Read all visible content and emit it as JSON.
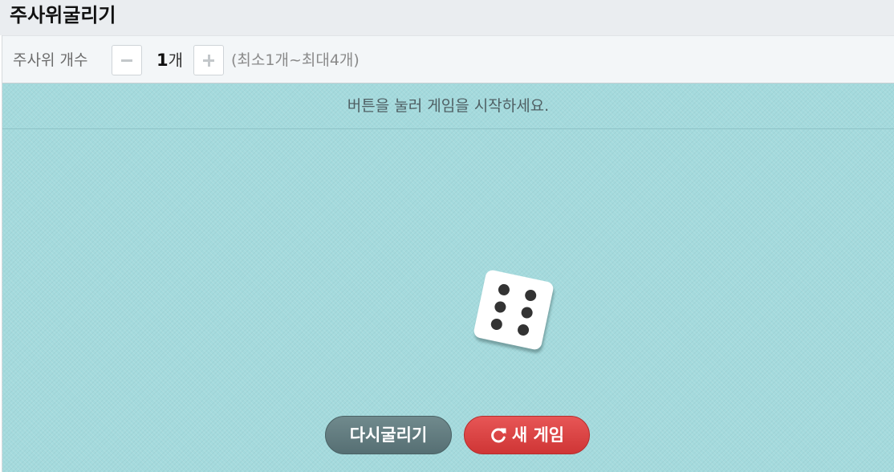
{
  "header": {
    "title": "주사위굴리기"
  },
  "controls": {
    "label": "주사위 개수",
    "count_value": "1",
    "count_unit": "개",
    "range_hint": "(최소1개~최대4개)",
    "minus_icon": "minus-icon",
    "plus_icon": "plus-icon"
  },
  "board": {
    "message": "버튼을 눌러 게임을 시작하세요.",
    "background_color": "#a4dadd",
    "dice": [
      {
        "face_value": 6
      }
    ]
  },
  "buttons": {
    "reroll_label": "다시굴리기",
    "new_game_label": "새 게임",
    "new_game_icon": "refresh-icon",
    "reroll_color": "#607b7e",
    "new_game_color": "#dc4545"
  }
}
